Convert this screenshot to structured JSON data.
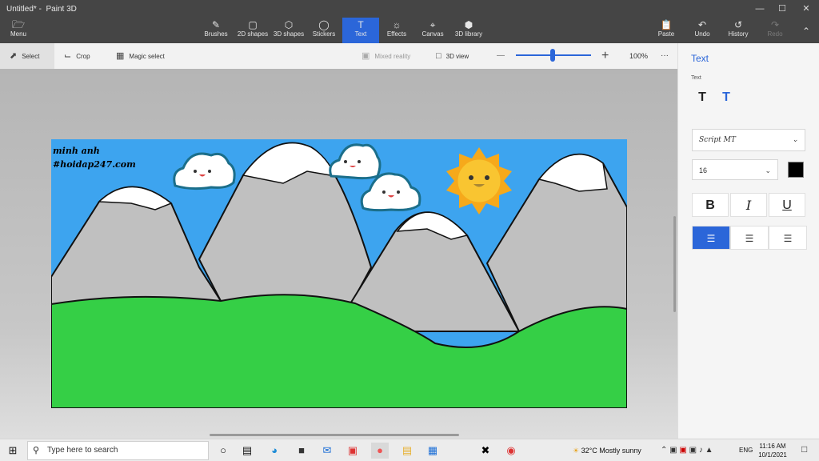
{
  "window": {
    "title": "Untitled*",
    "app": "Paint 3D",
    "separator": "-"
  },
  "menu": {
    "label": "Menu",
    "icon": "folder-icon"
  },
  "ribbon": {
    "tools": [
      {
        "label": "Brushes",
        "icon": "brush-icon"
      },
      {
        "label": "2D shapes",
        "icon": "shapes-2d-icon"
      },
      {
        "label": "3D shapes",
        "icon": "cube-icon"
      },
      {
        "label": "Stickers",
        "icon": "sticker-icon"
      },
      {
        "label": "Text",
        "icon": "text-icon"
      },
      {
        "label": "Effects",
        "icon": "sun-icon"
      },
      {
        "label": "Canvas",
        "icon": "canvas-icon"
      },
      {
        "label": "3D library",
        "icon": "library-icon"
      }
    ],
    "right": [
      {
        "label": "Paste",
        "icon": "paste-icon"
      },
      {
        "label": "Undo",
        "icon": "undo-icon"
      },
      {
        "label": "History",
        "icon": "history-icon"
      },
      {
        "label": "Redo",
        "icon": "redo-icon"
      }
    ],
    "active_color": "#2b66d9"
  },
  "toolbar": {
    "select": "Select",
    "crop": "Crop",
    "magic_select": "Magic select",
    "mixed_reality": "Mixed reality",
    "view_3d": "3D view",
    "zoom": "100%",
    "zoom_minus": "—",
    "zoom_plus": "+",
    "more": "···"
  },
  "canvas": {
    "text_line1": "minh anh",
    "text_line2": "#hoidap247.com",
    "sky_color": "#3da4ef",
    "grass_color": "#35cf46",
    "mountain_color": "#c0c0c0"
  },
  "panel": {
    "title": "Text",
    "subtitle": "Text",
    "font": "Script MT",
    "size": "16",
    "bold": "B",
    "italic": "I",
    "underline": "U",
    "color": "#000000"
  },
  "taskbar": {
    "search_placeholder": "Type here to search",
    "weather": "32°C  Mostly sunny",
    "lang": "ENG",
    "time": "11:16 AM",
    "date": "10/1/2021"
  }
}
